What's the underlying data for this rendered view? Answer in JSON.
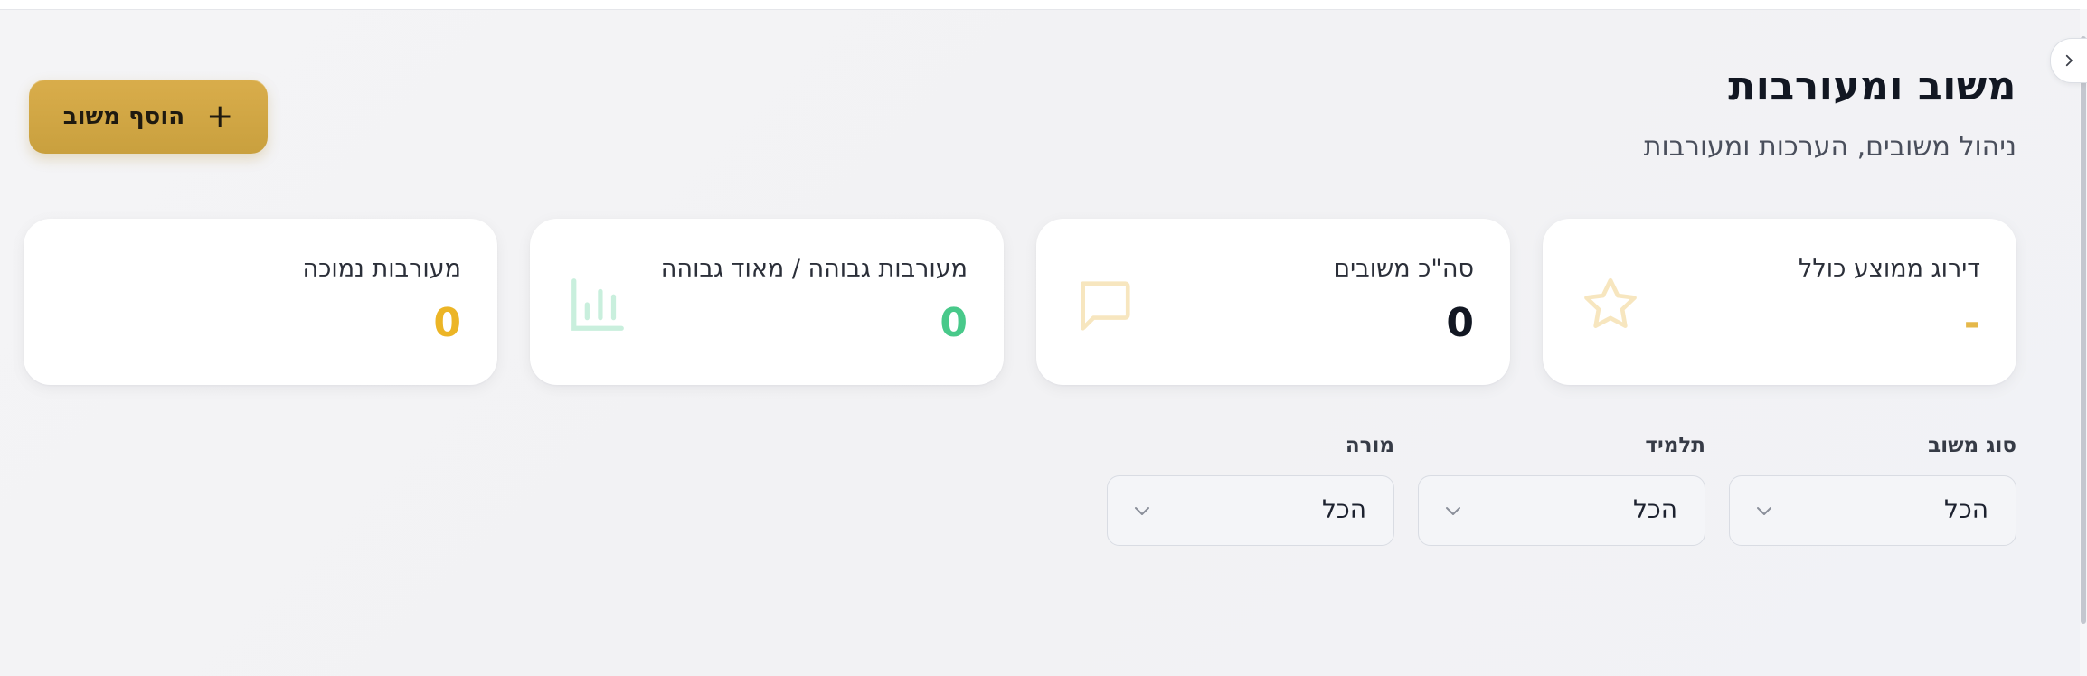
{
  "header": {
    "title": "משוב ומעורבות",
    "subtitle": "ניהול משובים, הערכות ומעורבות",
    "add_button_label": "הוסף משוב",
    "add_button_icon": "plus-icon"
  },
  "stats": [
    {
      "label": "דירוג ממוצע כולל",
      "value": "-",
      "value_color": "#e5b84a",
      "icon": "star-icon",
      "icon_color": "#f7e6bf"
    },
    {
      "label": "סה\"כ משובים",
      "value": "0",
      "value_color": "#121722",
      "icon": "message-icon",
      "icon_color": "#f7e6bf"
    },
    {
      "label": "מעורבות גבוהה / מאוד גבוהה",
      "value": "0",
      "value_color": "#48c98a",
      "icon": "bar-chart-icon",
      "icon_color": "#c9efdd"
    },
    {
      "label": "מעורבות נמוכה",
      "value": "0",
      "value_color": "#ecb526"
    }
  ],
  "filters": [
    {
      "label": "סוג משוב",
      "value": "הכל"
    },
    {
      "label": "תלמיד",
      "value": "הכל"
    },
    {
      "label": "מורה",
      "value": "הכל"
    }
  ],
  "sidebar_toggle_icon": "chevron-right-icon"
}
